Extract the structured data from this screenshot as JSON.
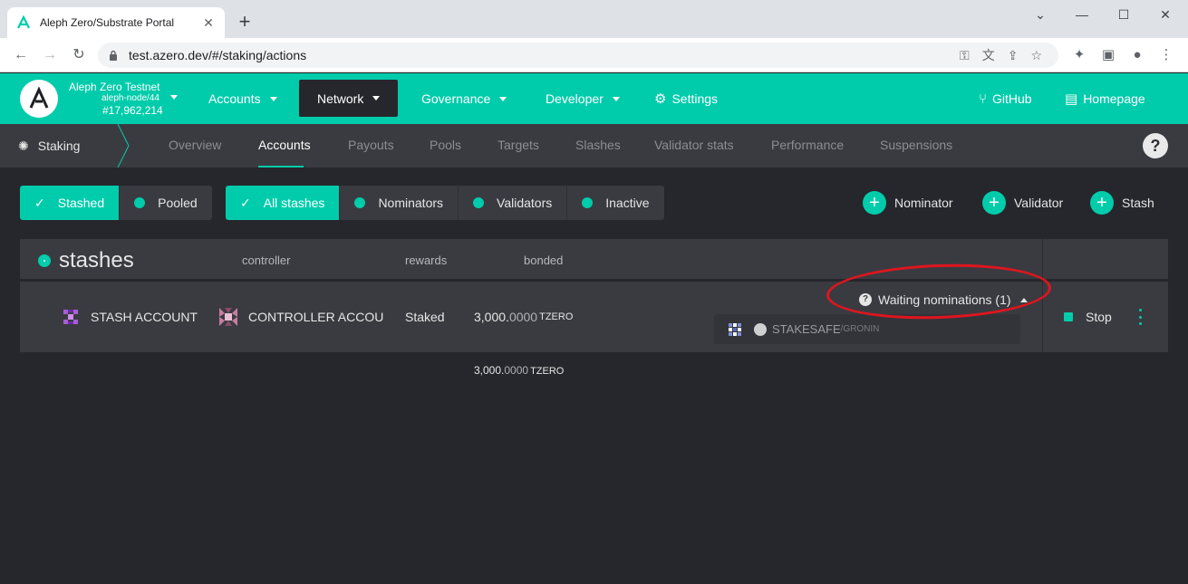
{
  "browser": {
    "tab_title": "Aleph Zero/Substrate Portal",
    "url": "test.azero.dev/#/staking/actions"
  },
  "app": {
    "chain_name": "Aleph Zero Testnet",
    "node": "aleph-node/44",
    "block": "#17,962,214",
    "menu": {
      "accounts": "Accounts",
      "network": "Network",
      "governance": "Governance",
      "developer": "Developer",
      "settings": "Settings",
      "github": "GitHub",
      "homepage": "Homepage"
    }
  },
  "subnav": {
    "section": "Staking",
    "tabs": [
      "Overview",
      "Accounts",
      "Payouts",
      "Pools",
      "Targets",
      "Slashes",
      "Validator stats",
      "Performance",
      "Suspensions"
    ],
    "active": "Accounts",
    "help": "?"
  },
  "filters": {
    "type": [
      "Stashed",
      "Pooled"
    ],
    "role": [
      "All stashes",
      "Nominators",
      "Validators",
      "Inactive"
    ]
  },
  "actions": {
    "nominator": "Nominator",
    "validator": "Validator",
    "stash": "Stash"
  },
  "table": {
    "title": "stashes",
    "columns": {
      "controller": "controller",
      "rewards": "rewards",
      "bonded": "bonded"
    },
    "row": {
      "stash": "STASH ACCOUNT",
      "controller": "CONTROLLER ACCOU",
      "rewards": "Staked",
      "bonded_int": "3,000.",
      "bonded_dec": "0000",
      "unit": "TZERO",
      "waiting": "Waiting nominations (1)",
      "nominee_name": "STAKESAFE",
      "nominee_sub": "/GRONIN",
      "stop": "Stop"
    },
    "total": {
      "int": "3,000.",
      "dec": "0000",
      "unit": "TZERO"
    }
  },
  "colors": {
    "accent": "#00ccab",
    "background": "#26272c",
    "panel": "#3a3b40",
    "annotation": "#e0151e"
  }
}
